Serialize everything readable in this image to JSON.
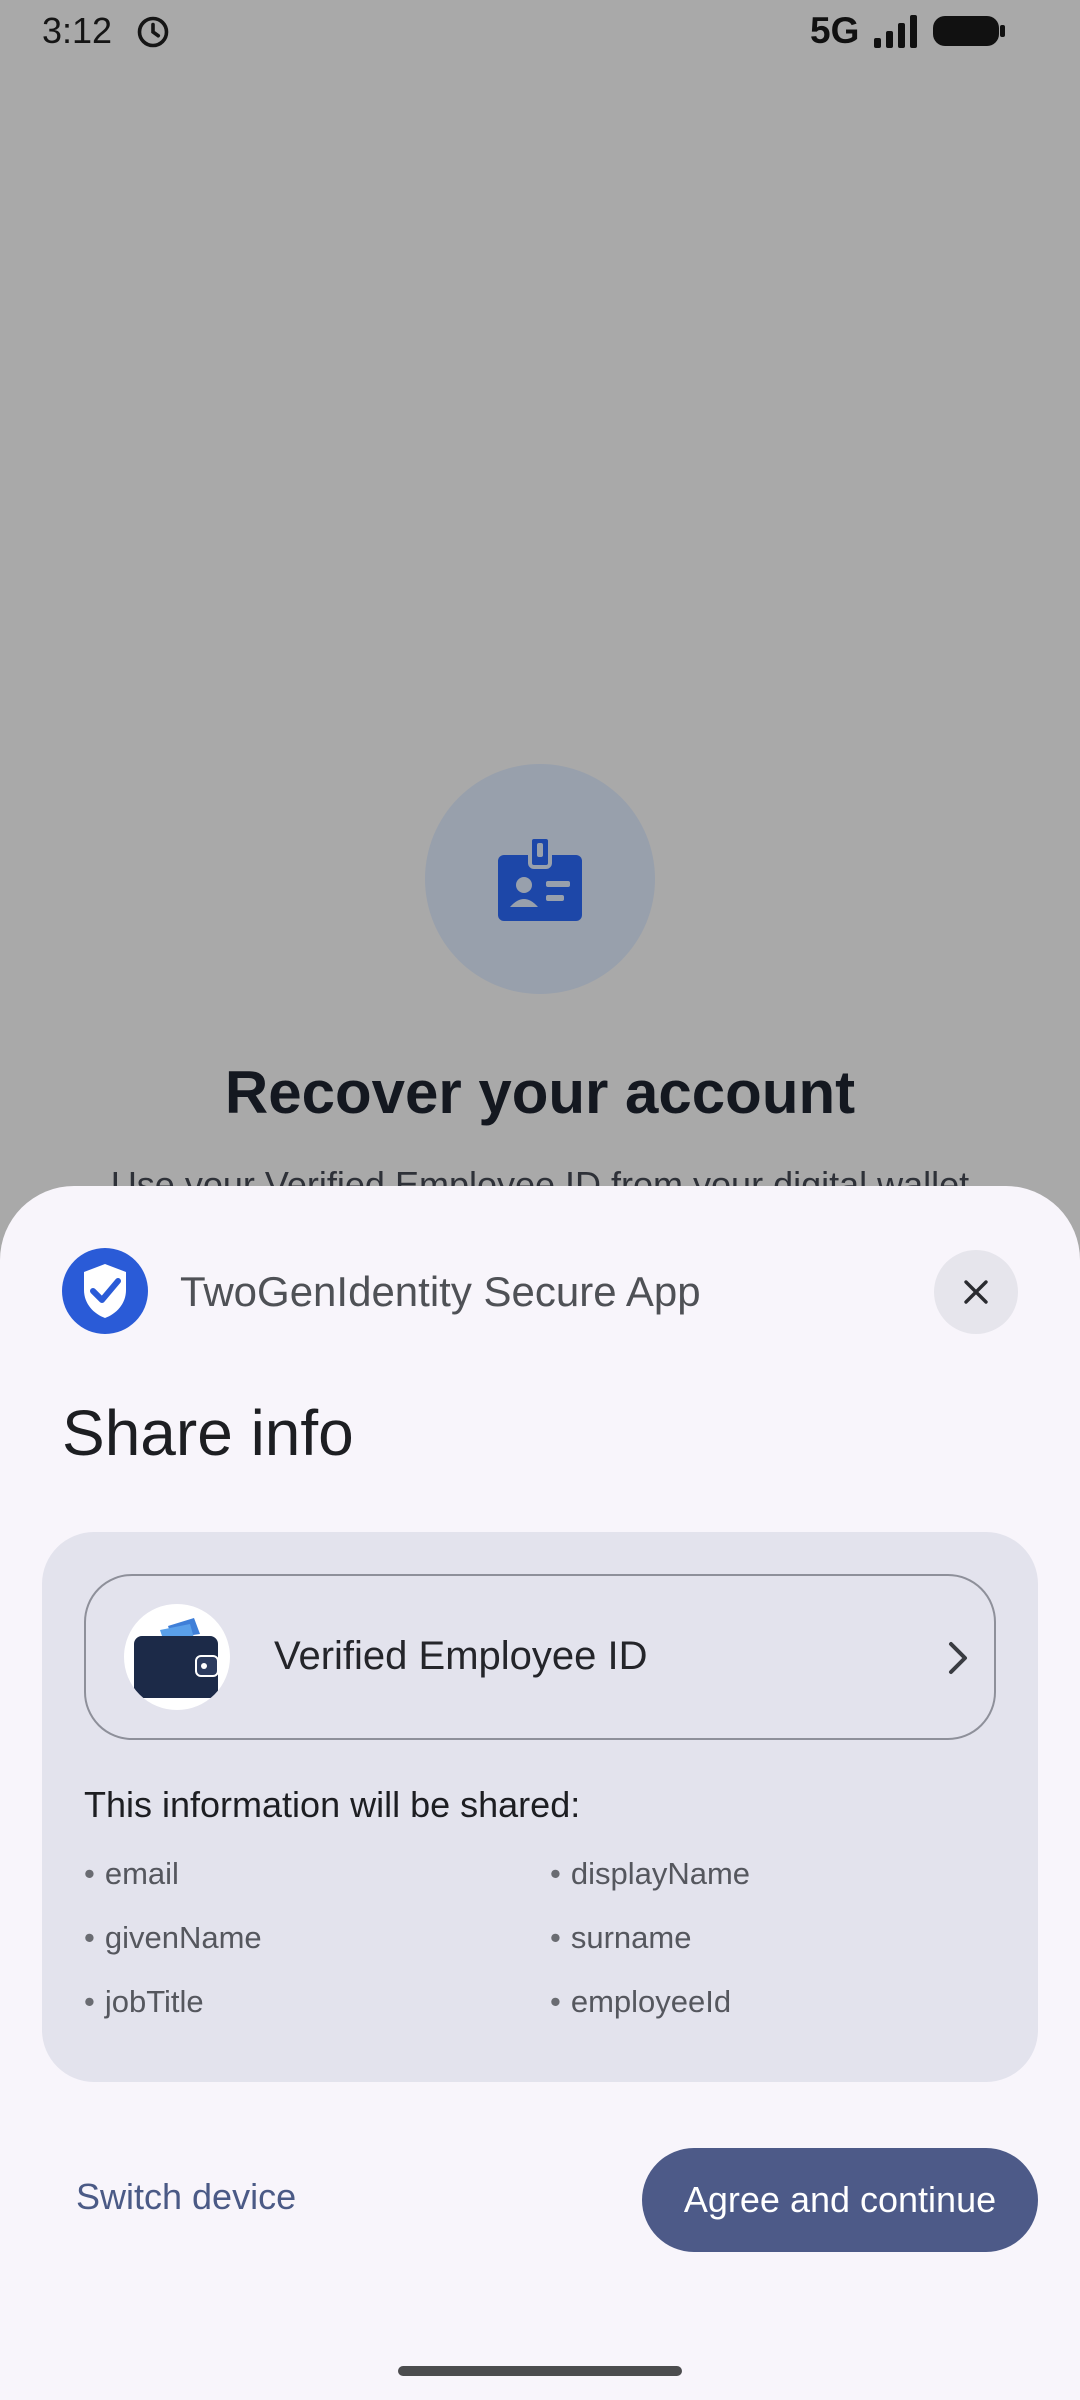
{
  "status_bar": {
    "time": "3:12",
    "network": "5G",
    "icons": [
      "alarm-icon",
      "signal-icon",
      "battery-icon"
    ]
  },
  "background_page": {
    "icon": "id-badge-icon",
    "title": "Recover your account",
    "subtitle": "Use your Verified Employee ID from your digital wallet"
  },
  "sheet": {
    "app_icon": "shield-check-icon",
    "app_name": "TwoGenIdentity Secure App",
    "close_icon": "close-icon",
    "title": "Share info",
    "credential": {
      "icon": "wallet-icon",
      "label": "Verified Employee ID",
      "chevron": "chevron-right-icon"
    },
    "shared_heading": "This information will be shared:",
    "attributes": [
      "email",
      "displayName",
      "givenName",
      "surname",
      "jobTitle",
      "employeeId"
    ],
    "switch_device_label": "Switch device",
    "agree_label": "Agree and continue"
  },
  "colors": {
    "scrim": "#a9a9a9",
    "sheet_bg": "#f8f5fb",
    "card_bg": "#e3e3ed",
    "primary": "#4d5a88",
    "brand_blue": "#2a5bd7"
  }
}
